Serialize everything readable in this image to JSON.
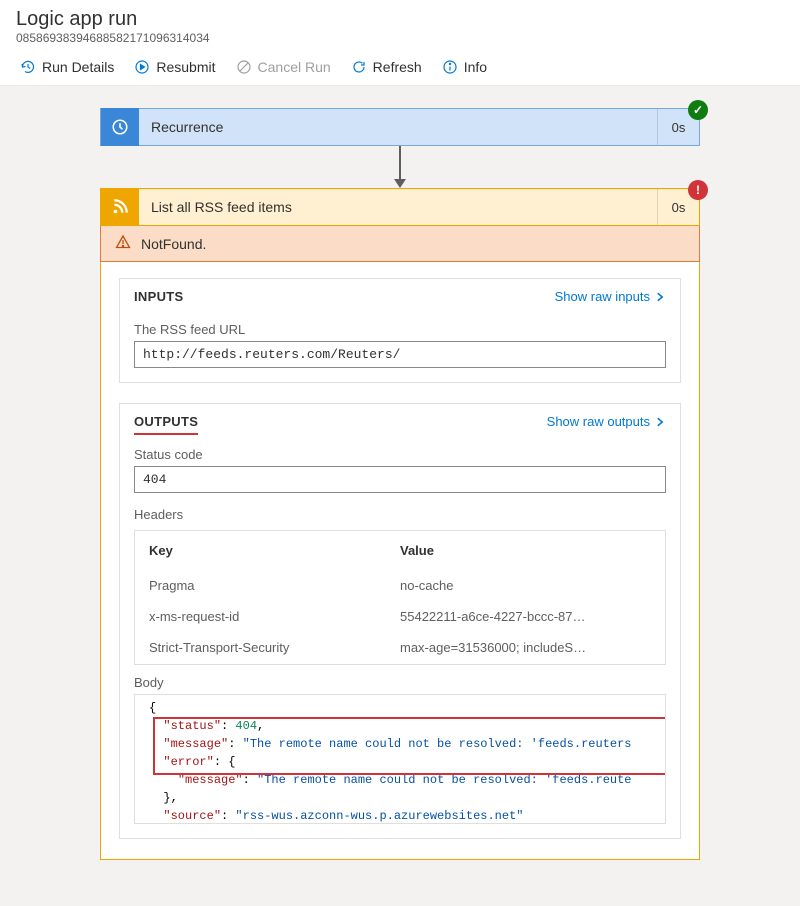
{
  "page": {
    "title": "Logic app run",
    "runId": "08586938394688582171096314034"
  },
  "toolbar": {
    "runDetails": "Run Details",
    "resubmit": "Resubmit",
    "cancelRun": "Cancel Run",
    "refresh": "Refresh",
    "info": "Info"
  },
  "steps": {
    "recurrence": {
      "title": "Recurrence",
      "duration": "0s"
    },
    "rss": {
      "title": "List all RSS feed items",
      "duration": "0s",
      "error": "NotFound."
    }
  },
  "inputs": {
    "sectionLabel": "INPUTS",
    "rawLink": "Show raw inputs",
    "feedUrlLabel": "The RSS feed URL",
    "feedUrl": "http://feeds.reuters.com/Reuters/"
  },
  "outputs": {
    "sectionLabel": "OUTPUTS",
    "rawLink": "Show raw outputs",
    "statusLabel": "Status code",
    "statusCode": "404",
    "headersLabel": "Headers",
    "headerKey": "Key",
    "headerValue": "Value",
    "headers": [
      {
        "key": "Pragma",
        "value": "no-cache"
      },
      {
        "key": "x-ms-request-id",
        "value": "55422211-a6ce-4227-bccc-87…"
      },
      {
        "key": "Strict-Transport-Security",
        "value": "max-age=31536000; includeS…"
      }
    ],
    "bodyLabel": "Body",
    "body": {
      "status": 404,
      "message": "The remote name could not be resolved: 'feeds.reuters",
      "errorMessage": "The remote name could not be resolved: 'feeds.reute",
      "source": "rss-wus.azconn-wus.p.azurewebsites.net"
    }
  }
}
